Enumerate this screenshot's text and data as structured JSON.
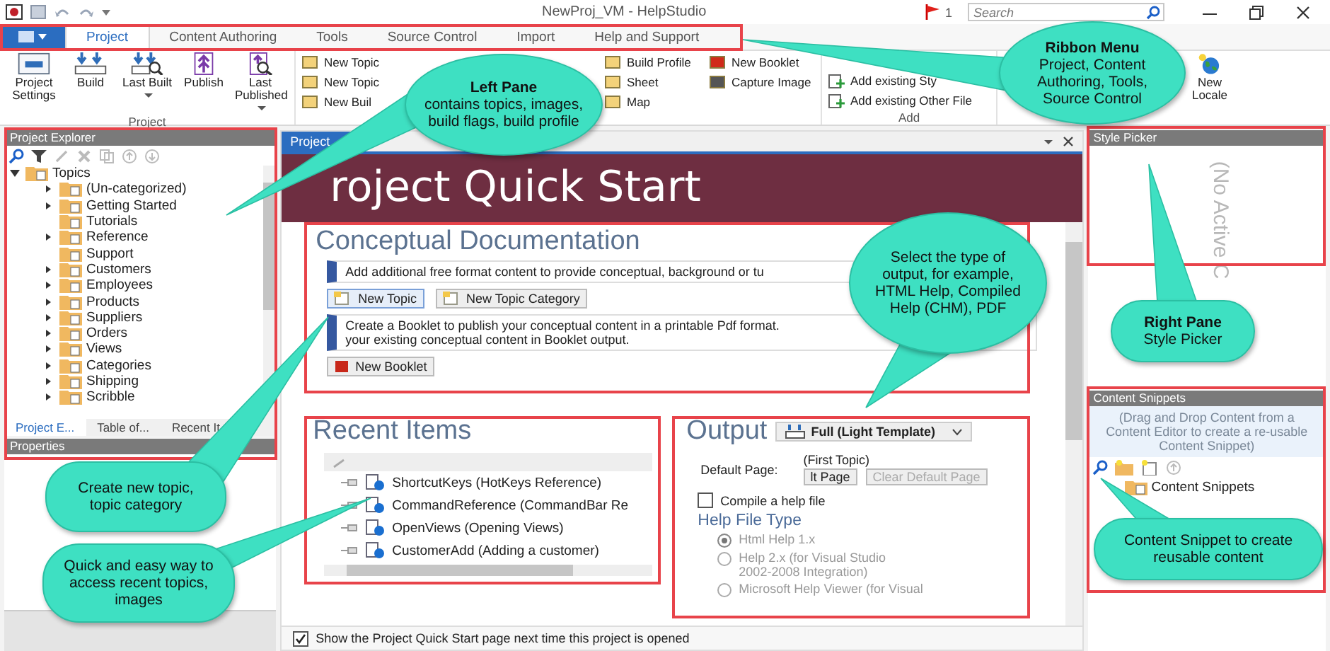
{
  "window": {
    "title": "NewProj_VM - HelpStudio",
    "notifications": "1",
    "search": {
      "placeholder": "Search"
    }
  },
  "ribbon": {
    "tabs": [
      {
        "label": "Project",
        "selected": true
      },
      {
        "label": "Content Authoring",
        "selected": false
      },
      {
        "label": "Tools",
        "selected": false
      },
      {
        "label": "Source Control",
        "selected": false
      },
      {
        "label": "Import",
        "selected": false
      },
      {
        "label": "Help and Support",
        "selected": false
      }
    ],
    "project_group": {
      "label": "Project",
      "buttons": [
        {
          "label": "Project Settings",
          "dropdown": false
        },
        {
          "label": "Build",
          "dropdown": false
        },
        {
          "label": "Last Built",
          "dropdown": true
        },
        {
          "label": "Publish",
          "dropdown": false
        },
        {
          "label": "Last Published",
          "dropdown": true
        }
      ]
    },
    "create_columns": [
      [
        "New Topic",
        "New Topic",
        "New Buil"
      ],
      [
        "Build Profile",
        "Sheet",
        "Map"
      ],
      [
        "New Booklet",
        "Capture Image"
      ]
    ],
    "add_group": {
      "label": "Add",
      "items": [
        "Add existing Sty",
        "Add existing Other File"
      ]
    },
    "locale_button": {
      "label": "New Locale"
    }
  },
  "project_explorer": {
    "title": "Project Explorer",
    "tree": [
      {
        "label": "Topics",
        "expanded": true,
        "children": [
          {
            "label": "(Un-categorized)",
            "expandable": true
          },
          {
            "label": "Getting Started",
            "expandable": true
          },
          {
            "label": "Tutorials",
            "expandable": false
          },
          {
            "label": "Reference",
            "expandable": true
          },
          {
            "label": "Support",
            "expandable": false
          },
          {
            "label": "Customers",
            "expandable": true
          },
          {
            "label": "Employees",
            "expandable": true
          },
          {
            "label": "Products",
            "expandable": true
          },
          {
            "label": "Suppliers",
            "expandable": true
          },
          {
            "label": "Orders",
            "expandable": true
          },
          {
            "label": "Views",
            "expandable": true
          },
          {
            "label": "Categories",
            "expandable": true
          },
          {
            "label": "Shipping",
            "expandable": true
          },
          {
            "label": "Scribble",
            "expandable": true
          }
        ]
      }
    ],
    "tabs": [
      {
        "label": "Project E...",
        "selected": true
      },
      {
        "label": "Table of...",
        "selected": false
      },
      {
        "label": "Recent It",
        "selected": false
      }
    ]
  },
  "properties": {
    "title": "Properties"
  },
  "document": {
    "tab": "Project",
    "banner": "roject Quick Start",
    "conceptual": {
      "heading": "Conceptual Documentation",
      "notes": [
        "Add additional free format content to provide conceptual, background or tu",
        "Create a Booklet to publish your conceptual content in a printable Pdf format.\nyour existing conceptual content in Booklet output."
      ],
      "topic_buttons": [
        "New Topic",
        "New Topic Category"
      ],
      "booklet_button": "New Booklet"
    },
    "recent": {
      "heading": "Recent Items",
      "items": [
        "ShortcutKeys (HotKeys Reference)",
        "CommandReference (CommandBar Re",
        "OpenViews (Opening Views)",
        "CustomerAdd (Adding a customer)"
      ]
    },
    "output": {
      "heading": "Output",
      "template": "Full (Light Template)",
      "default_page_label": "Default Page:",
      "default_page": "(First Topic)",
      "set_button": "lt Page",
      "clear_button": "Clear Default Page",
      "compile": {
        "label": "Compile a help file",
        "checked": false
      },
      "help_type_heading": "Help File Type",
      "help_types": [
        {
          "label": "Html Help 1.x",
          "selected": true
        },
        {
          "label": "Help 2.x (for Visual Studio\n2002-2008 Integration)",
          "selected": false
        },
        {
          "label": "Microsoft Help Viewer (for Visual",
          "selected": false
        }
      ]
    },
    "show_on_open": {
      "label": "Show the Project Quick Start page next time this project is opened",
      "checked": true
    }
  },
  "style_picker": {
    "title": "Style Picker",
    "empty_text": "(No Active C"
  },
  "content_snippets": {
    "title": "Content Snippets",
    "hint": "(Drag and Drop Content from a Content Editor to create a re-usable Content Snippet)",
    "tree": [
      "Content Snippets"
    ]
  },
  "callouts": [
    {
      "text": "**Left Pane**\ncontains topics, images, build flags, build profile"
    },
    {
      "text": "**Ribbon Menu**\nProject,  Content Authoring, Tools, Source Control"
    },
    {
      "text": "Select the type of output, for example, HTML Help, Compiled Help (CHM), PDF"
    },
    {
      "text": "**Right Pane**\nStyle Picker"
    },
    {
      "text": "Content Snippet to create reusable content"
    },
    {
      "text": "Create new topic, topic category"
    },
    {
      "text": "Quick and easy way to access recent topics, images"
    }
  ]
}
